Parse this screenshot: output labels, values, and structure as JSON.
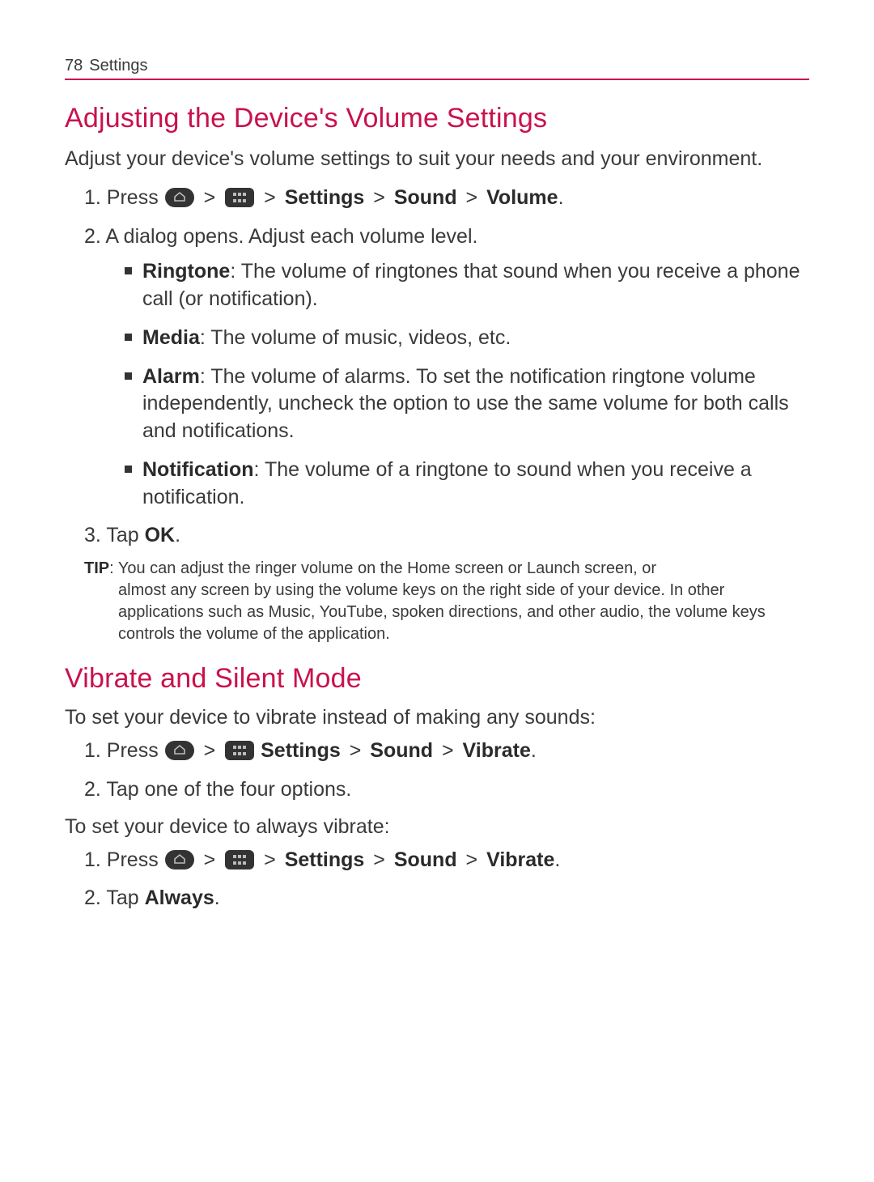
{
  "header": {
    "page_number": "78",
    "section": "Settings"
  },
  "sec1": {
    "title": "Adjusting the Device's Volume Settings",
    "intro": "Adjust your device's volume settings to suit your needs and your environment.",
    "step1_num": "1. ",
    "step1_press": "Press ",
    "path_settings": "Settings",
    "path_sound": "Sound",
    "path_volume": "Volume",
    "gt": ">",
    "period": ".",
    "step2_num": "2. ",
    "step2_text": "A dialog opens. Adjust each volume level.",
    "bullets": {
      "b1_term": "Ringtone",
      "b1_rest": ": The volume of ringtones that sound when you receive a phone call (or notification).",
      "b2_term": "Media",
      "b2_rest": ": The volume of music, videos, etc.",
      "b3_term": "Alarm",
      "b3_rest": ": The volume of alarms. To set the notification ringtone volume independently, uncheck the option to use the same volume for both calls and notifications.",
      "b4_term": "Notification",
      "b4_rest": ": The volume of a ringtone to sound when you receive a notification."
    },
    "step3_num": "3. ",
    "step3_pre": "Tap ",
    "step3_bold": "OK",
    "tip_label": "TIP",
    "tip_first": ": You can adjust the ringer volume on the Home screen or Launch screen, or",
    "tip_rest": "almost any screen by using the volume keys on the right side of your device. In other applications such as Music, YouTube, spoken directions, and other audio, the volume keys controls the volume of the application."
  },
  "sec2": {
    "title": "Vibrate and Silent Mode",
    "subA": "To set your device to vibrate instead of making any sounds:",
    "a1_num": "1. ",
    "a1_press": "Press ",
    "path_vibrate": "Vibrate",
    "a2_num": "2. ",
    "a2_text": "Tap one of the four options.",
    "subB": "To set your device to always vibrate:",
    "b1_num": "1. ",
    "b1_press": "Press ",
    "b2_num": "2. ",
    "b2_pre": "Tap ",
    "b2_bold": "Always"
  }
}
